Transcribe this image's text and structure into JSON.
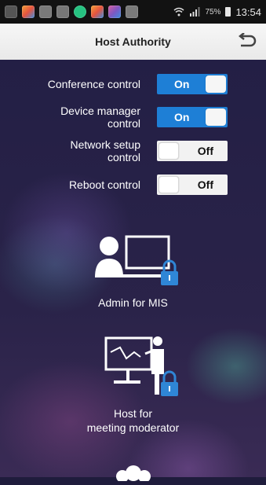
{
  "status_bar": {
    "battery": "75%",
    "time": "13:54",
    "app_icons": [
      "chat-icon",
      "photos-icon",
      "camera-icon",
      "gallery-icon",
      "whatsapp-icon",
      "photos-icon",
      "photos-icon",
      "camera-icon"
    ],
    "icon_colors": [
      "#555555",
      "#f2a23a",
      "#7a7a7a",
      "#777777",
      "#26c281",
      "#f2a23a",
      "#d95f9e",
      "#7a7a7a"
    ]
  },
  "header": {
    "title": "Host Authority",
    "back_icon": "back-icon"
  },
  "controls": [
    {
      "label": "Conference control",
      "state": "On"
    },
    {
      "label": "Device manager control",
      "label_lines": [
        "Device manager",
        "control"
      ],
      "state": "On"
    },
    {
      "label": "Network setup control",
      "label_lines": [
        "Network setup",
        "control"
      ],
      "state": "Off"
    },
    {
      "label": "Reboot control",
      "state": "Off"
    }
  ],
  "roles": [
    {
      "label": "Admin for MIS",
      "icon": "admin-lock-icon"
    },
    {
      "label_lines": [
        "Host for",
        "meeting moderator"
      ],
      "icon": "presenter-lock-icon"
    },
    {
      "icon": "group-icon"
    }
  ],
  "colors": {
    "accent": "#1e7fd6",
    "lock": "#2f86d6"
  }
}
